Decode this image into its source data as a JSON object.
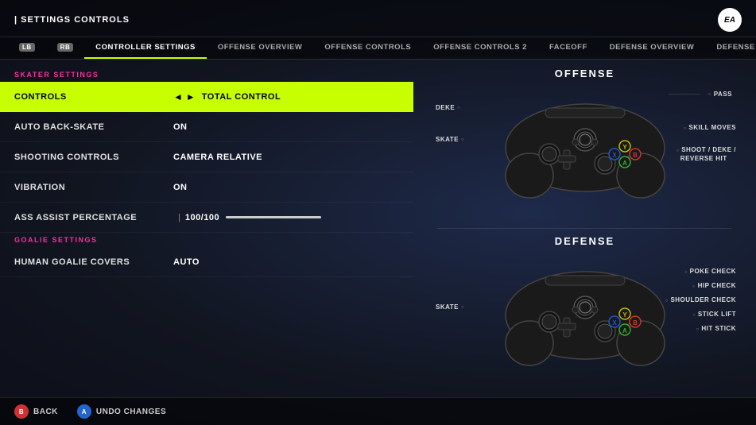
{
  "header": {
    "breadcrumb_prefix": "| SETTINGS",
    "breadcrumb_section": "CONTROLS",
    "ea_logo": "EA"
  },
  "tabs": [
    {
      "id": "lb",
      "label": "LB",
      "badge": true,
      "active": false
    },
    {
      "id": "rb",
      "label": "RB",
      "badge": true,
      "active": false
    },
    {
      "id": "controller-settings",
      "label": "CONTROLLER SETTINGS",
      "active": true
    },
    {
      "id": "offense-overview",
      "label": "OFFENSE OVERVIEW",
      "active": false
    },
    {
      "id": "offense-controls",
      "label": "OFFENSE CONTROLS",
      "active": false
    },
    {
      "id": "offense-controls-2",
      "label": "OFFENSE CONTROLS 2",
      "active": false
    },
    {
      "id": "faceoff",
      "label": "FACEOFF",
      "active": false
    },
    {
      "id": "defense-overview",
      "label": "DEFENSE OVERVIEW",
      "active": false
    },
    {
      "id": "defense-controls",
      "label": "DEFENSE CONTROLS",
      "active": false
    }
  ],
  "skater_settings_label": "SKATER SETTINGS",
  "goalie_settings_label": "GOALIE SETTINGS",
  "settings": [
    {
      "id": "controls",
      "label": "CONTROLS",
      "value": "TOTAL CONTROL",
      "highlighted": true,
      "has_arrows": true
    },
    {
      "id": "auto-back-skate",
      "label": "AUTO BACK-SKATE",
      "value": "ON",
      "highlighted": false,
      "has_arrows": false
    },
    {
      "id": "shooting-controls",
      "label": "SHOOTING CONTROLS",
      "value": "CAMERA RELATIVE",
      "highlighted": false,
      "has_arrows": false
    },
    {
      "id": "vibration",
      "label": "VIBRATION",
      "value": "ON",
      "highlighted": false,
      "has_arrows": false
    },
    {
      "id": "ass-assist",
      "label": "ASS ASSIST PERCENTAGE",
      "value": "100/100",
      "slider_pct": 100,
      "highlighted": false,
      "has_arrows": false,
      "has_slider": true
    }
  ],
  "goalie_settings": [
    {
      "id": "human-goalie-covers",
      "label": "HUMAN GOALIE COVERS",
      "value": "AUTO",
      "highlighted": false
    }
  ],
  "offense_controller": {
    "title": "OFFENSE",
    "labels": [
      {
        "text": "PASS",
        "position": "top-right"
      },
      {
        "text": "DEKE",
        "position": "left-top"
      },
      {
        "text": "SKATE",
        "position": "left-bottom"
      },
      {
        "text": "SKILL MOVES",
        "position": "right-middle"
      },
      {
        "text": "SHOOT / DEKE / REVERSE HIT",
        "position": "right-bottom"
      }
    ]
  },
  "defense_controller": {
    "title": "DEFENSE",
    "labels": [
      {
        "text": "POKE CHECK",
        "position": "right-top1"
      },
      {
        "text": "HIP CHECK",
        "position": "right-top2"
      },
      {
        "text": "SHOULDER CHECK",
        "position": "right-mid"
      },
      {
        "text": "STICK LIFT",
        "position": "right-bot1"
      },
      {
        "text": "HIT STICK",
        "position": "right-bot2"
      },
      {
        "text": "SKATE",
        "position": "left"
      }
    ]
  },
  "footer": {
    "back_label": "BACK",
    "back_btn": "B",
    "undo_label": "UNDO CHANGES",
    "undo_btn": "A"
  }
}
